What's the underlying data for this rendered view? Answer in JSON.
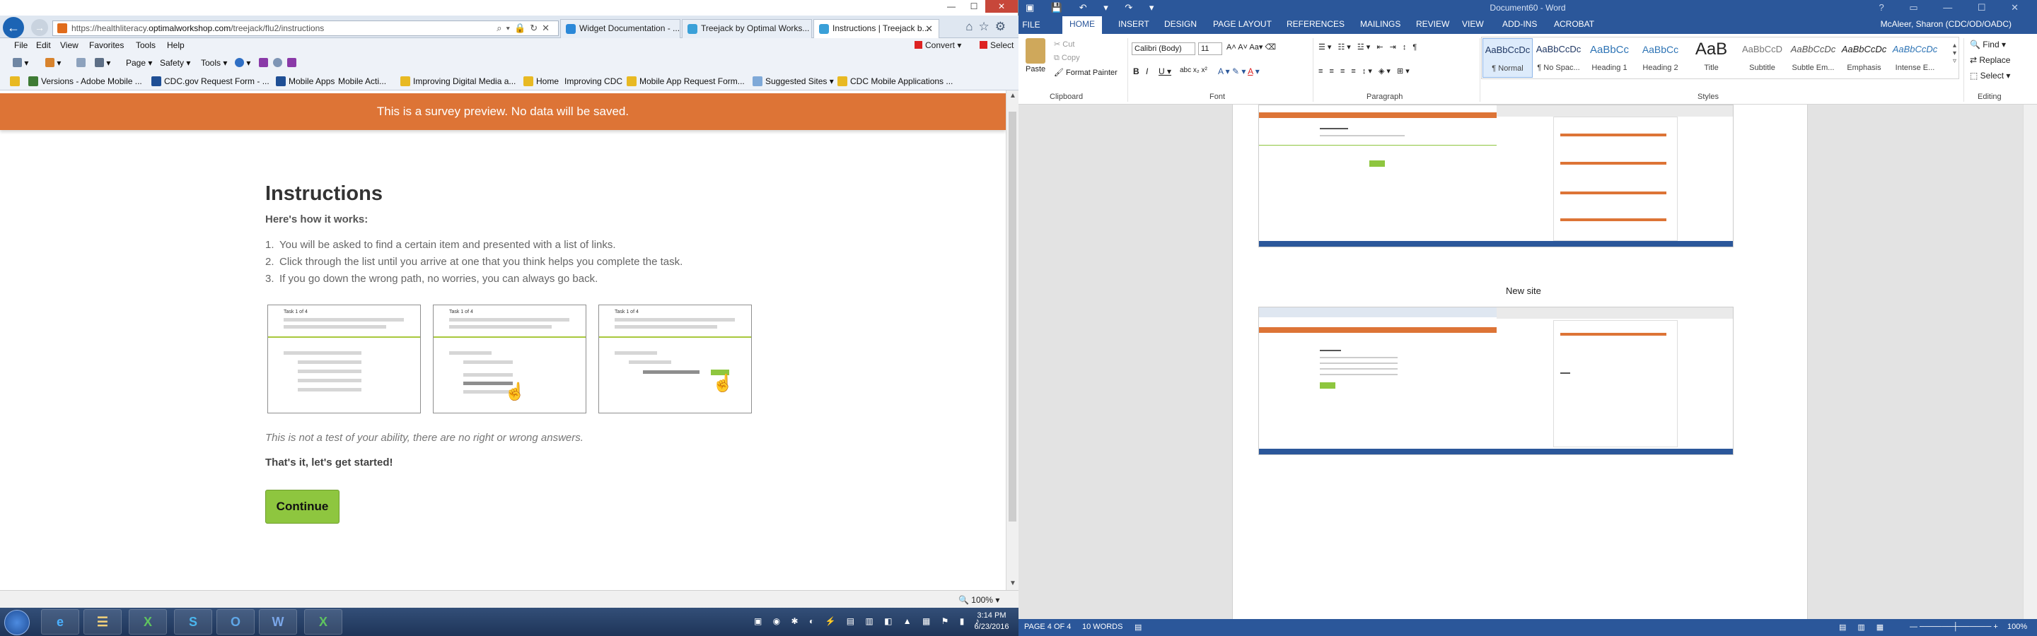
{
  "ie": {
    "url_prefix": "https://healthliteracy.",
    "url_domain": "optimalworkshop.com",
    "url_path": "/treejack/flu2/instructions",
    "tabs": [
      {
        "label": "Widget Documentation - ..."
      },
      {
        "label": "Treejack by Optimal Works..."
      },
      {
        "label": "Instructions | Treejack b..."
      }
    ],
    "menu": [
      "File",
      "Edit",
      "View",
      "Favorites",
      "Tools",
      "Help"
    ],
    "convert_label": "Convert",
    "select_label": "Select",
    "commands": [
      "Page",
      "Safety",
      "Tools"
    ],
    "favorites": [
      "Versions - Adobe Mobile ...",
      "CDC.gov Request Form - ...",
      "Mobile Apps",
      "Mobile Acti...",
      "Improving Digital Media a...",
      "Home",
      "Improving CDC",
      "Mobile App Request Form...",
      "Suggested Sites",
      "CDC Mobile Applications ..."
    ],
    "zoom": "100%"
  },
  "survey": {
    "banner": "This is a survey preview. No data will be saved.",
    "title": "Instructions",
    "subtitle": "Here's how it works:",
    "steps": [
      {
        "num": "1.",
        "text": "You will be asked to find a certain item and presented with a list of links."
      },
      {
        "num": "2.",
        "text": "Click through the list until you arrive at one that you think helps you complete the task."
      },
      {
        "num": "3.",
        "text": "If you go down the wrong path, no worries, you can always go back."
      }
    ],
    "card_label": "Task 1 of 4",
    "note": "This is not a test of your ability, there are no right or wrong answers.",
    "started": "That's it, let's get started!",
    "continue": "Continue"
  },
  "word": {
    "title": "Document60 - Word",
    "tabs": [
      "HOME",
      "INSERT",
      "DESIGN",
      "PAGE LAYOUT",
      "REFERENCES",
      "MAILINGS",
      "REVIEW",
      "VIEW",
      "ADD-INS",
      "ACROBAT"
    ],
    "file_tab": "FILE",
    "user": "McAleer, Sharon (CDC/OD/OADC)",
    "clipboard": {
      "paste": "Paste",
      "cut": "Cut",
      "copy": "Copy",
      "format_painter": "Format Painter",
      "group": "Clipboard"
    },
    "font": {
      "name": "Calibri (Body)",
      "size": "11",
      "group": "Font"
    },
    "paragraph_group": "Paragraph",
    "styles_group": "Styles",
    "styles": [
      {
        "sample": "AaBbCcDc",
        "name": "¶ Normal"
      },
      {
        "sample": "AaBbCcDc",
        "name": "¶ No Spac..."
      },
      {
        "sample": "AaBbCc",
        "name": "Heading 1"
      },
      {
        "sample": "AaBbCc",
        "name": "Heading 2"
      },
      {
        "sample": "AaB",
        "name": "Title"
      },
      {
        "sample": "AaBbCcD",
        "name": "Subtitle"
      },
      {
        "sample": "AaBbCcDc",
        "name": "Subtle Em..."
      },
      {
        "sample": "AaBbCcDc",
        "name": "Emphasis"
      },
      {
        "sample": "AaBbCcDc",
        "name": "Intense E..."
      }
    ],
    "editing": {
      "find": "Find",
      "replace": "Replace",
      "select": "Select",
      "group": "Editing"
    },
    "doc_heading": "New site",
    "status": {
      "page": "PAGE 4 OF 4",
      "words": "10 WORDS",
      "zoom": "100%"
    }
  },
  "taskbar": {
    "apps": [
      "e",
      "☰",
      "X",
      "S",
      "O",
      "W",
      "X"
    ],
    "time": "3:14 PM",
    "date": "6/23/2016"
  },
  "colors": {
    "banner": "#dd7436",
    "continue": "#8ec63f",
    "word_blue": "#2b579a",
    "ie_blue": "#1c64b4"
  }
}
